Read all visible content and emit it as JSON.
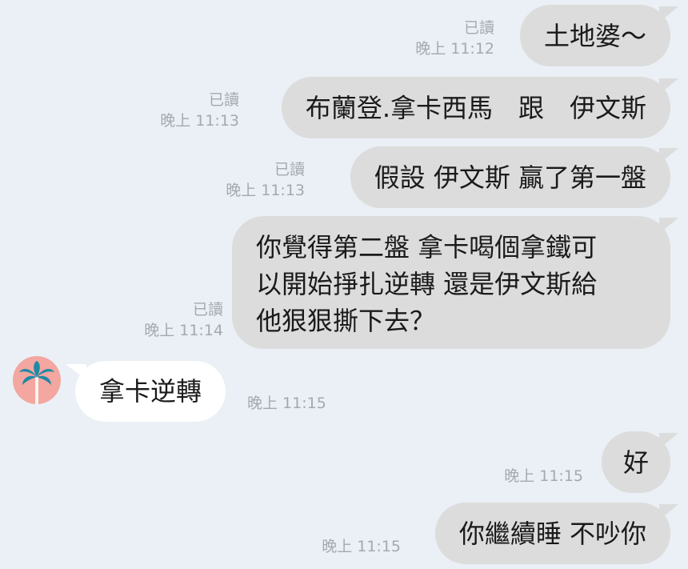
{
  "messages": [
    {
      "text": "土地婆～",
      "read": "已讀",
      "time": "晚上 11:12"
    },
    {
      "text": "布蘭登.拿卡西馬　跟　伊文斯",
      "read": "已讀",
      "time": "晚上 11:13"
    },
    {
      "text": "假設 伊文斯 贏了第一盤",
      "read": "已讀",
      "time": "晚上 11:13"
    },
    {
      "lines": [
        "你覺得第二盤 拿卡喝個拿鐵可",
        "以開始掙扎逆轉 還是伊文斯給",
        "他狠狠撕下去？"
      ],
      "read": "已讀",
      "time": "晚上 11:14"
    },
    {
      "text": "拿卡逆轉",
      "time": "晚上 11:15"
    },
    {
      "text": "好",
      "time": "晚上 11:15"
    },
    {
      "text": "你繼續睡 不吵你",
      "time": "晚上 11:15"
    }
  ],
  "icons": {
    "avatar": "palm-tree-icon"
  },
  "colors": {
    "background": "#eaf0f5",
    "outgoing_bubble": "#dcdcdc",
    "incoming_bubble": "#ffffff",
    "meta_text": "#a4a9ae",
    "avatar_bg": "#f4a6a0",
    "palm": "#1e8aa6"
  }
}
